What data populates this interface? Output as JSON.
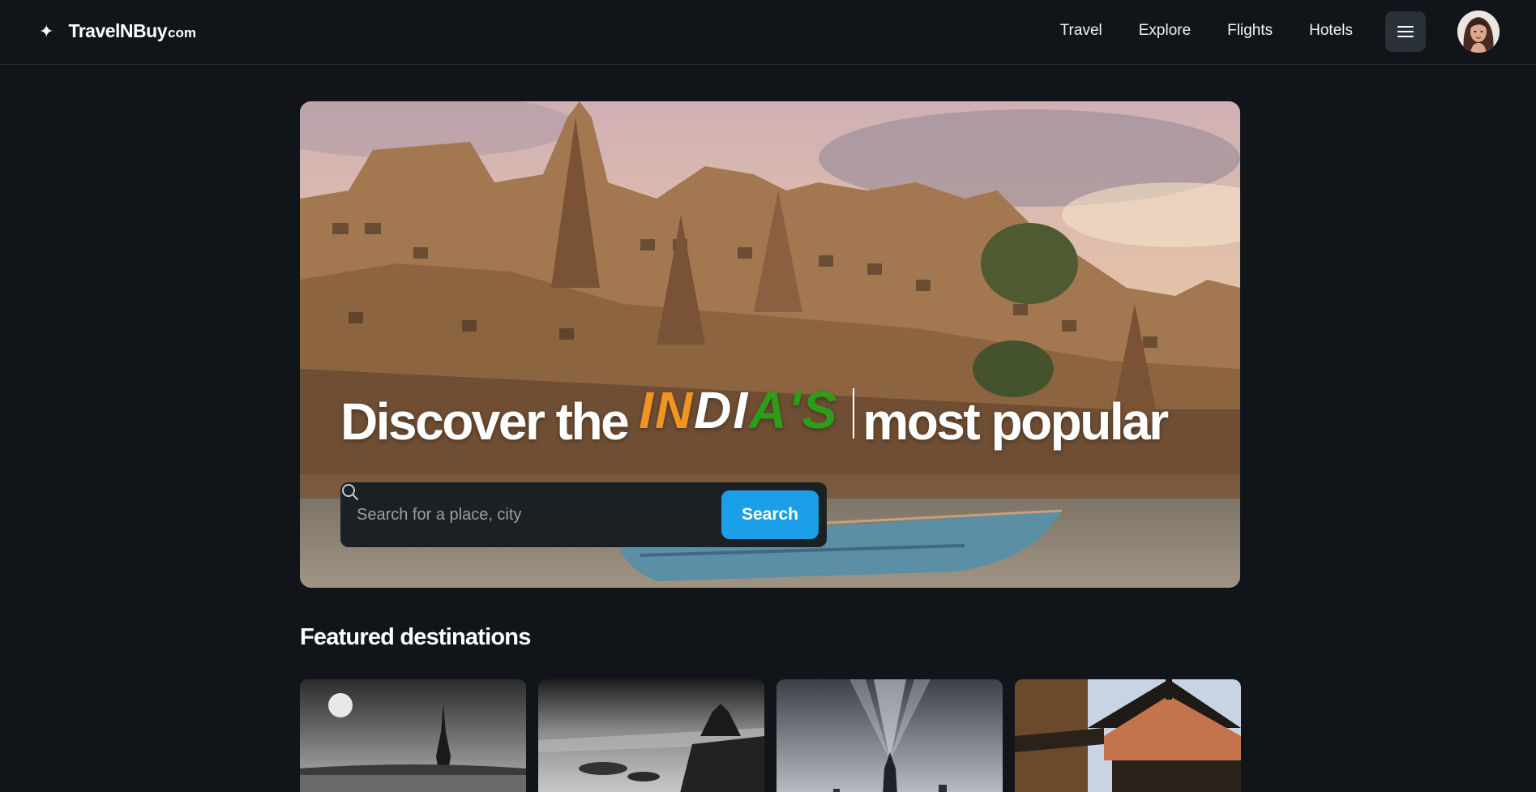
{
  "header": {
    "logo_icon": "sparkle-icon",
    "brand_main": "TravelNBuy",
    "brand_tld": "com",
    "nav": [
      {
        "label": "Travel"
      },
      {
        "label": "Explore"
      },
      {
        "label": "Flights"
      },
      {
        "label": "Hotels"
      }
    ],
    "menu_icon": "hamburger-icon",
    "avatar_alt": "User avatar"
  },
  "hero": {
    "headline_before": "Discover the",
    "india_letters": [
      {
        "char": "I",
        "color": "#f29422"
      },
      {
        "char": "N",
        "color": "#f29422"
      },
      {
        "char": "D",
        "color": "#ffffff"
      },
      {
        "char": "I",
        "color": "#ffffff"
      },
      {
        "char": "A",
        "color": "#2e9c19"
      },
      {
        "char": "'",
        "color": "#2e9c19"
      },
      {
        "char": "S",
        "color": "#2e9c19"
      }
    ],
    "headline_after": "most popular",
    "search": {
      "placeholder": "Search for a place, city",
      "value": "",
      "button_label": "Search",
      "icon": "search-icon"
    }
  },
  "featured": {
    "title": "Featured destinations",
    "cards": [
      {
        "name": "eiffel-tower-card"
      },
      {
        "name": "pagoda-seascape-card"
      },
      {
        "name": "skyline-searchlight-card"
      },
      {
        "name": "japanese-temple-card"
      }
    ]
  },
  "colors": {
    "background": "#11151a",
    "accent": "#1a9fe8",
    "saffron": "#f29422",
    "green": "#2e9c19"
  }
}
